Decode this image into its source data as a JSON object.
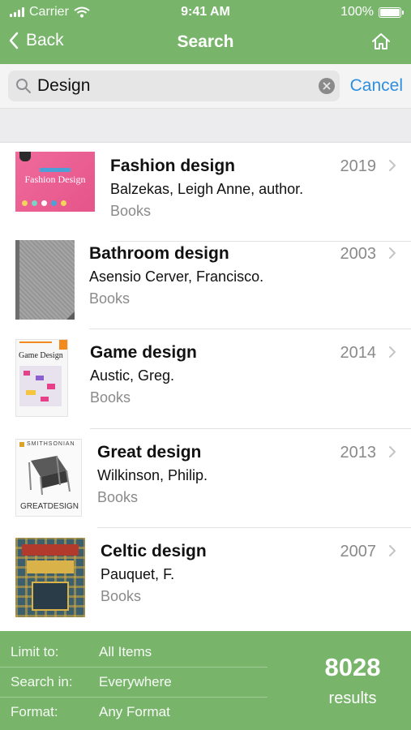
{
  "status_bar": {
    "carrier": "Carrier",
    "time": "9:41 AM",
    "battery": "100%"
  },
  "nav": {
    "back_label": "Back",
    "title": "Search"
  },
  "search": {
    "value": "Design",
    "cancel_label": "Cancel"
  },
  "results": [
    {
      "title": "Fashion design",
      "author": "Balzekas, Leigh Anne, author.",
      "format": "Books",
      "year": "2019",
      "cover_text": "Fashion Design"
    },
    {
      "title": "Bathroom design",
      "author": "Asensio Cerver, Francisco.",
      "format": "Books",
      "year": "2003"
    },
    {
      "title": "Game design",
      "author": "Austic, Greg.",
      "format": "Books",
      "year": "2014",
      "cover_text": "Game Design"
    },
    {
      "title": "Great design",
      "author": "Wilkinson, Philip.",
      "format": "Books",
      "year": "2013",
      "cover_text": "GREATDESIGN",
      "cover_brand": "SMITHSONIAN"
    },
    {
      "title": "Celtic design",
      "author": "Pauquet, F.",
      "format": "Books",
      "year": "2007"
    }
  ],
  "filters": [
    {
      "label": "Limit to:",
      "value": "All Items"
    },
    {
      "label": "Search in:",
      "value": "Everywhere"
    },
    {
      "label": "Format:",
      "value": "Any Format"
    }
  ],
  "result_count": {
    "value": "8028",
    "label": "results"
  },
  "colors": {
    "brand": "#78b56b",
    "link": "#2c8fe0",
    "muted": "#8a8a8a"
  },
  "icons": [
    "signal-icon",
    "wifi-icon",
    "battery-icon",
    "back-chevron-icon",
    "home-icon",
    "search-icon",
    "clear-icon",
    "chevron-right-icon"
  ]
}
